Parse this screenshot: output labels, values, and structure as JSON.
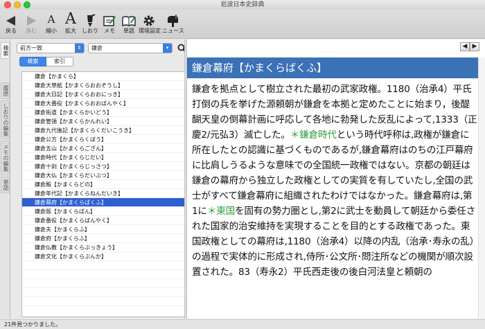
{
  "window": {
    "title": "岩波日本史辞典"
  },
  "toolbar": {
    "buttons": [
      {
        "label": "戻る",
        "icon": "back-arrow-icon"
      },
      {
        "label": "進む",
        "icon": "forward-arrow-icon"
      },
      {
        "label": "縮小",
        "icon": "shrink-text-icon"
      },
      {
        "label": "拡大",
        "icon": "enlarge-text-icon"
      },
      {
        "label": "しおり",
        "icon": "bookmark-icon"
      },
      {
        "label": "メモ",
        "icon": "memo-icon"
      },
      {
        "label": "単語",
        "icon": "word-icon"
      },
      {
        "label": "環境設定",
        "icon": "gear-icon"
      },
      {
        "label": "ニュース",
        "icon": "mailbox-icon"
      }
    ]
  },
  "sidetabs": [
    {
      "label": "検索"
    },
    {
      "label": "履歴"
    },
    {
      "label": "しおりの編集"
    },
    {
      "label": "メモの編集"
    },
    {
      "label": "単語"
    }
  ],
  "search": {
    "mode": "前方一致",
    "query": "鎌倉",
    "tabs": [
      {
        "label": "検索"
      },
      {
        "label": "索引"
      }
    ]
  },
  "results": [
    "鎌倉【かまくら】",
    "鎌倉大草紙【かまくらおおぞうし】",
    "鎌倉大日記【かまくらおおにっき】",
    "鎌倉大番役【かまくらおおばんやく】",
    "鎌倉街道【かまくらかいどう】",
    "鎌倉管領【かまくらかんれい】",
    "鎌倉九代後記【かまくらくだいこうき】",
    "鎌倉公方【かまくらくぼう】",
    "鎌倉五山【かまくらござん】",
    "鎌倉時代【かまくらじだい】",
    "鎌倉十刹【かまくらじっさつ】",
    "鎌倉大仏【かまくらだいぶつ】",
    "鎌倉殿【かまくらどの】",
    "鎌倉年代記【かまくらねんだいき】",
    "鎌倉幕府【かまくらばくふ】",
    "鎌倉版【かまくらばん】",
    "鎌倉番役【かまくらばんやく】",
    "鎌倉夫【かまくらふ】",
    "鎌倉府【かまくらふ】",
    "鎌倉仏教【かまくらぶっきょう】",
    "鎌倉文化【かまくらぶんか】"
  ],
  "selected_index": 14,
  "article": {
    "title": "鎌倉幕府【かまくらばくふ】",
    "p1": "鎌倉を拠点として樹立された最初の武家政権。1180（治承4）平氏打倒の兵を挙げた源頼朝が鎌倉を本拠と定めたことに始まり，後醍醐天皇の倒幕計画に呼応して各地に勃発した反乱によって,1333（正慶2/元弘3）滅亡した。",
    "ref1": "＊鎌倉時代",
    "p2": "という時代呼称は,政権が鎌倉に所在したとの認識に基づくものであるが,鎌倉幕府はのちの江戸幕府に比肩しうるような意味での全国統一政権ではない。京都の朝廷は鎌倉の幕府から独立した政権としての実質を有していたし,全国の武士がすべて鎌倉幕府に組織されたわけではなかった。鎌倉幕府は,第1に",
    "ref2": "＊東国",
    "p3": "を固有の勢力圏とし,第2に武士を動員して朝廷から委任された国家的治安維持を実現することを目的とする政権であった。東国政権としての幕府は,1180（治承4）以降の内乱（治承･寿永の乱）の過程で実体的に形成され,侍所･公文所･問注所などの機関が順次設置された。83（寿永2）平氏西走後の後白河法皇と頼朝の"
  },
  "status": {
    "text": "21件見つかりました。"
  }
}
